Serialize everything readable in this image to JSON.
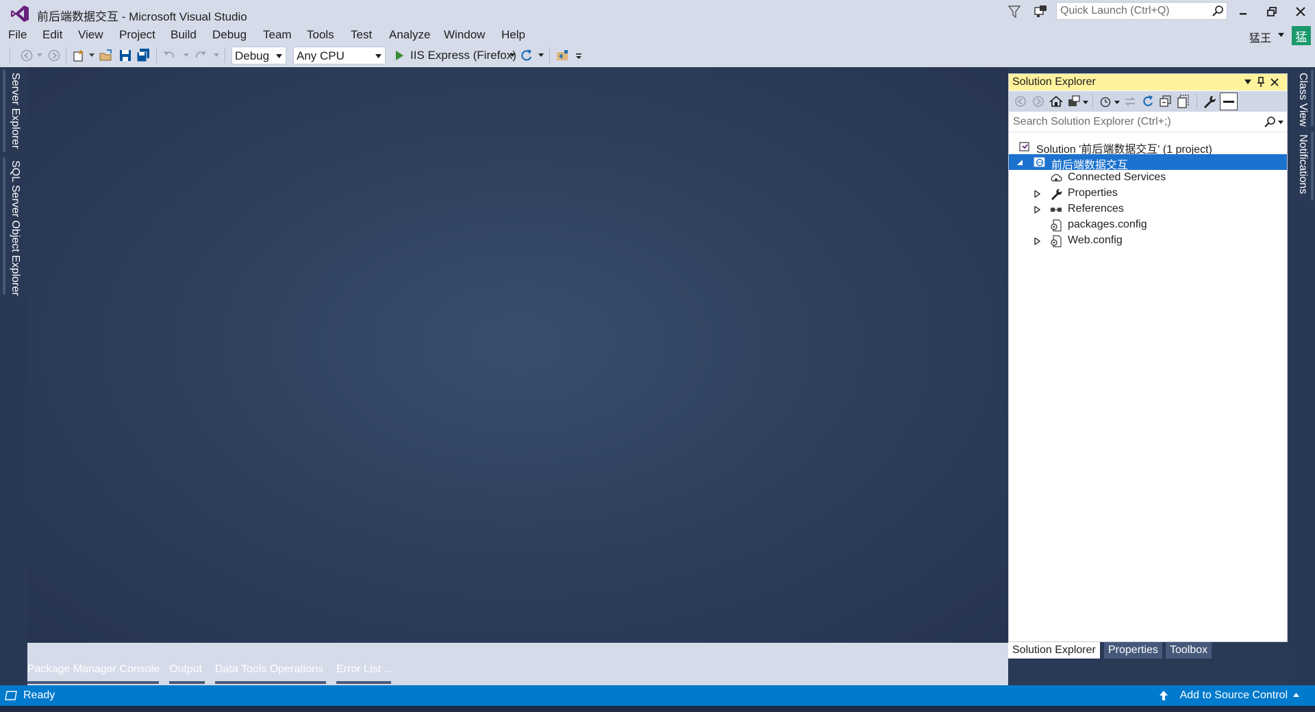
{
  "window": {
    "title": "前后端数据交互 - Microsoft Visual Studio",
    "quick_launch_placeholder": "Quick Launch (Ctrl+Q)",
    "user_name": "猛王",
    "user_avatar": "猛"
  },
  "menu": [
    "File",
    "Edit",
    "View",
    "Project",
    "Build",
    "Debug",
    "Team",
    "Tools",
    "Test",
    "Analyze",
    "Window",
    "Help"
  ],
  "toolbar": {
    "config": "Debug",
    "platform": "Any CPU",
    "run_target": "IIS Express (Firefox)"
  },
  "left_rail": [
    "Server Explorer",
    "SQL Server Object Explorer"
  ],
  "right_rail": [
    "Class View",
    "Notifications"
  ],
  "solution_explorer": {
    "title": "Solution Explorer",
    "search_placeholder": "Search Solution Explorer (Ctrl+;)",
    "tree": [
      {
        "label": "Solution '前后端数据交互' (1 project)",
        "icon": "solution-icon"
      },
      {
        "label": "前后端数据交互",
        "icon": "web-project-icon",
        "selected": true,
        "expanded": true
      },
      {
        "label": "Connected Services",
        "icon": "connected-services-icon"
      },
      {
        "label": "Properties",
        "icon": "wrench-icon",
        "expandable": true
      },
      {
        "label": "References",
        "icon": "references-icon",
        "expandable": true
      },
      {
        "label": "packages.config",
        "icon": "config-file-icon"
      },
      {
        "label": "Web.config",
        "icon": "config-file-icon",
        "expandable": true
      }
    ],
    "tabs": [
      "Solution Explorer",
      "Properties",
      "Toolbox"
    ]
  },
  "bottom_tabs": [
    "Package Manager Console",
    "Output",
    "Data Tools Operations",
    "Error List ..."
  ],
  "status": {
    "ready": "Ready",
    "source_control": "Add to Source Control"
  },
  "colors": {
    "accent": "#007acc",
    "chrome": "#d6dbe9",
    "selection": "#1c72cf",
    "tool_header": "#fff29d",
    "doc_bg": "#2e3f5c"
  }
}
